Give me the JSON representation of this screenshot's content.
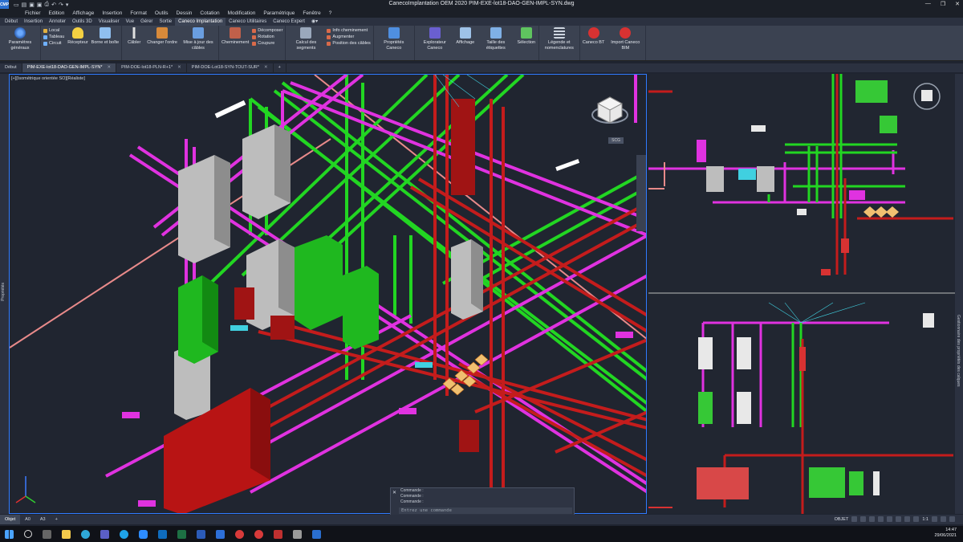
{
  "titlebar": {
    "app_logo": "CMP",
    "title": "CanecoImplantation OEM 2020   PIM-EXE-lot18-DAO-GEN-IMPL-SYN.dwg",
    "controls": [
      "—",
      "❐",
      "✕"
    ]
  },
  "menu": [
    "Fichier",
    "Edition",
    "Affichage",
    "Insertion",
    "Format",
    "Outils",
    "Dessin",
    "Cotation",
    "Modification",
    "Paramétrique",
    "Fenêtre",
    "?"
  ],
  "ribbon_tabs": [
    {
      "label": "Début",
      "active": false
    },
    {
      "label": "Insertion",
      "active": false
    },
    {
      "label": "Annoter",
      "active": false
    },
    {
      "label": "Outils 3D",
      "active": false
    },
    {
      "label": "Visualiser",
      "active": false
    },
    {
      "label": "Vue",
      "active": false
    },
    {
      "label": "Gérer",
      "active": false
    },
    {
      "label": "Sortie",
      "active": false
    },
    {
      "label": "Caneco Implantation",
      "active": true
    },
    {
      "label": "Caneco Utilitaires",
      "active": false
    },
    {
      "label": "Caneco Expert",
      "active": false
    }
  ],
  "ribbon": {
    "parametres": "Paramètres généraux",
    "local": "Local",
    "tableau": "Tableau",
    "circuit": "Circuit",
    "recepteur": "Récepteur",
    "borne": "Borne et boîte",
    "cabler": "Câbler",
    "changer": "Changer l'ordre",
    "mise_a_jour": "Mise à jour des câbles",
    "cheminement": "Cheminement",
    "decomposer": "Décomposer",
    "rotation": "Rotation",
    "coupure": "Coupure",
    "calcul": "Calcul des segments",
    "info_chem": "Info cheminement",
    "augmenter": "Augmenter",
    "position_cables": "Position des câbles",
    "proprietes": "Propriétés Caneco",
    "explorateur": "Explorateur Caneco",
    "affichage": "Affichage",
    "taille_etiq": "Taille des étiquettes",
    "selection": "Sélection",
    "legende": "Légende et nomenclatures",
    "caneco_bt": "Caneco BT",
    "import_bim": "Import Caneco BIM"
  },
  "doc_tabs": [
    {
      "label": "Début",
      "active": false,
      "closable": false
    },
    {
      "label": "PIM-EXE-lot18-DAO-GEN-IMPL-SYN*",
      "active": true,
      "closable": true
    },
    {
      "label": "PIM-DOE-lot18-PLN-R+1*",
      "active": false,
      "closable": true
    },
    {
      "label": "PIM-DOE-Lot18-SYN-TOUT-SUR*",
      "active": false,
      "closable": true
    },
    {
      "label": "+",
      "active": false,
      "closable": false
    }
  ],
  "viewport": {
    "label": "[+][Isométrique orientée SO][Réaliste]",
    "viewcube_label": "SCG"
  },
  "side_panels": {
    "left": "Propriétés",
    "right": "Gestionnaire des propriétés des calques"
  },
  "command": {
    "history": [
      "Commande :",
      "Commande :",
      "Commande :"
    ],
    "placeholder": "Entrez une commande"
  },
  "layout_tabs": [
    {
      "label": "Objet",
      "active": true
    },
    {
      "label": "A0",
      "active": false
    },
    {
      "label": "A3",
      "active": false
    },
    {
      "label": "+",
      "active": false
    }
  ],
  "status": {
    "mode": "OBJET",
    "scale": "1:1"
  },
  "taskbar": {
    "time": "14:47",
    "date": "29/06/2021"
  },
  "colors": {
    "pipe_green": "#22d622",
    "pipe_magenta": "#e032e0",
    "pipe_red": "#c41c1c",
    "pipe_pink": "#e88a8a",
    "cabinet_gray": "#bdbdbd",
    "accent_blue": "#2f7bff"
  }
}
